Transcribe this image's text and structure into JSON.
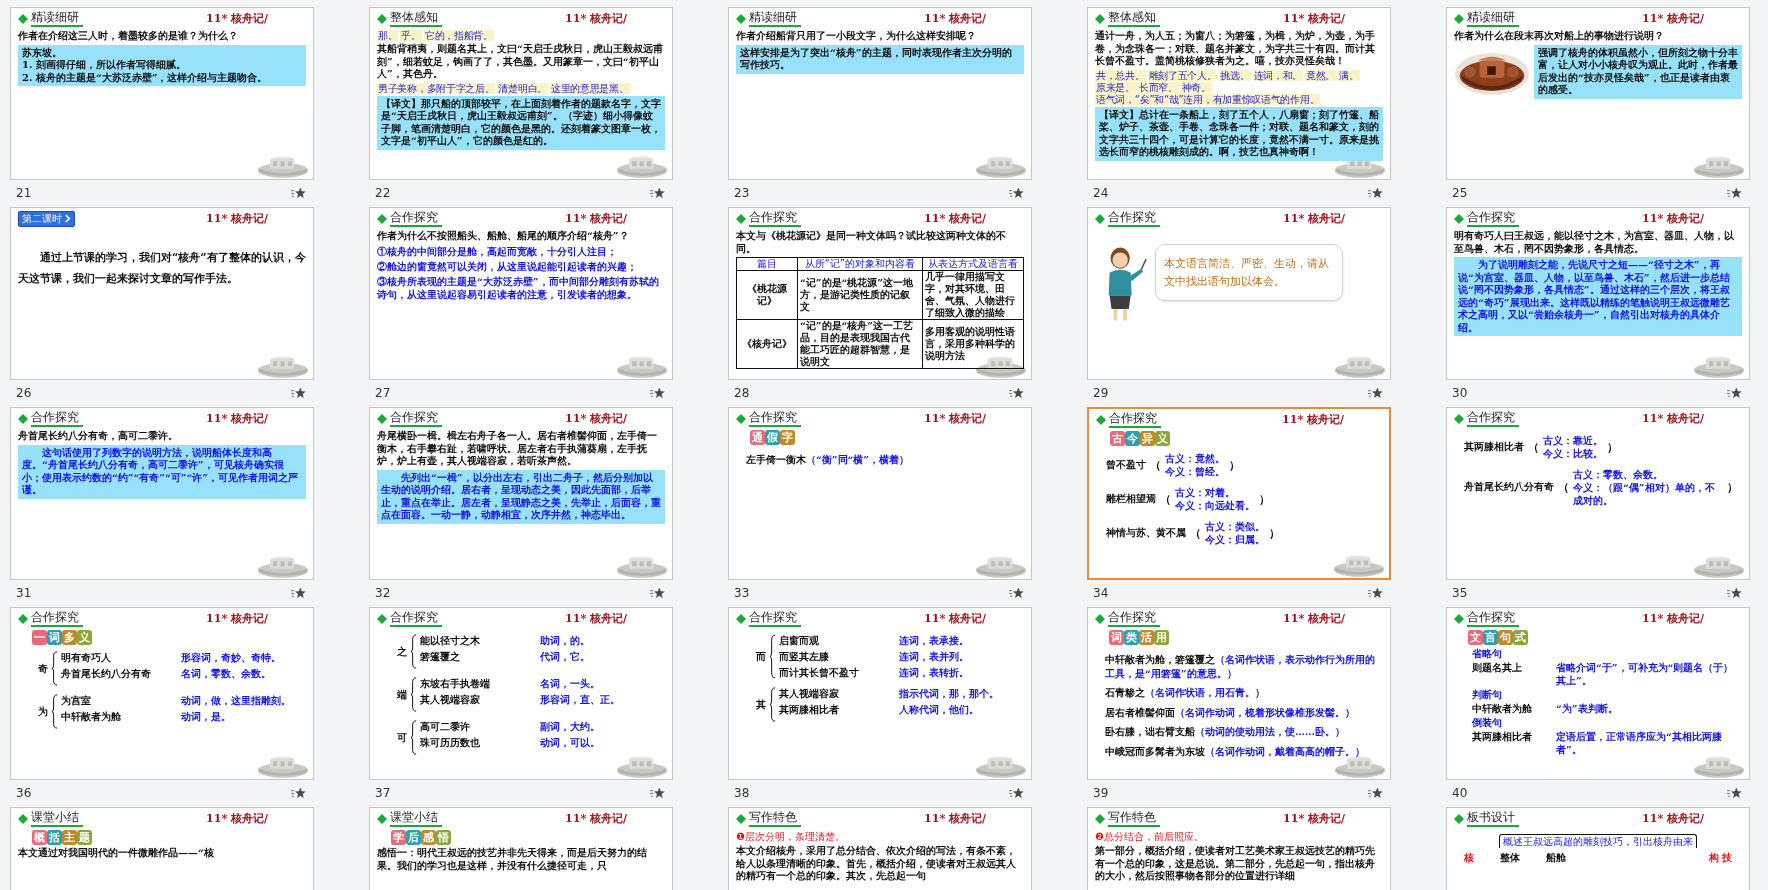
{
  "slides": [
    {
      "number": "21",
      "selected": false,
      "header": {
        "kind": "section",
        "title": "精读细研"
      },
      "brand": "11* 核舟记/",
      "blocks": [
        {
          "kind": "text",
          "text": "作者在介绍这三人时，着墨较多的是谁？为什么？"
        },
        {
          "kind": "box",
          "lines": [
            "苏东坡。",
            "1. 刻画得仔细，所以作者写得细腻。",
            "2. 核舟的主题是“大苏泛赤壁”，这样介绍与主题吻合。"
          ]
        }
      ]
    },
    {
      "number": "22",
      "selected": false,
      "header": {
        "kind": "section",
        "title": "整体感知"
      },
      "brand": "11* 核舟记/",
      "blocks": [
        {
          "kind": "notes",
          "notes": [
            "那。",
            "乎。",
            "它的，指船背。"
          ]
        },
        {
          "kind": "text",
          "text": "**其**船背稍**夷**，则题名**其**上，文曰“天启壬戌秋日，虎山王毅叔远**甫**刻”，细若蚊足，钩画**了了**，其色**墨**。又用篆章一，文曰“初平山人”，其色丹。"
        },
        {
          "kind": "notes",
          "notes": [
            "男子美称，多附于字之后。",
            "清楚明白。",
            "这里的意思是黑。"
          ]
        },
        {
          "kind": "box",
          "lines": [
            "**【译文】**那只船的顶部较平，在上面刻着作者的题款名字，文字是“天启壬戌秋日，虎山王毅叔远甫刻”。（字迹）细小得像蚊子脚，笔画清楚明白，它的颜色是黑的。还刻着篆文图章一枚，文字是“初平山人”，它的颜色是红的。"
          ]
        }
      ]
    },
    {
      "number": "23",
      "selected": false,
      "header": {
        "kind": "section",
        "title": "精读细研"
      },
      "brand": "11* 核舟记/",
      "blocks": [
        {
          "kind": "text",
          "text": "作者介绍船背只用了一小段文字，为什么这样安排呢？"
        },
        {
          "kind": "box",
          "lines": [
            "这样安排是为了突出“核舟”的主题，同时表现作者主次分明的写作技巧。"
          ]
        }
      ]
    },
    {
      "number": "24",
      "selected": false,
      "header": {
        "kind": "section",
        "title": "整体感知"
      },
      "brand": "11* 核舟记/",
      "blocks": [
        {
          "kind": "text",
          "text": "**通**计一舟，**为人五**；为窗八；为箬篷，为楫，为炉，为壶，为手卷，为念珠各一；对联、题名**并**篆文，为字共三十有四。而计其长**曾**不**盈**寸。**盖简**桃核**修狭**者为之。嘻，技亦**灵怪矣哉**！"
        },
        {
          "kind": "notes",
          "notes": [
            "共，总共。",
            "雕刻了五个人。",
            "挑选。",
            "连词，和。",
            "竟然。",
            "满。",
            "原来是。",
            "长而窄。",
            "神奇。",
            "语气词，“矣”和“哉”连用，有加重惊叹语气的作用。"
          ]
        },
        {
          "kind": "box",
          "lines": [
            "**【译文】**总计在一条船上，刻了五个人，八扇窗；刻了竹篷、船桨、炉子、茶壶、手卷、念珠各一件；对联、题名和篆文，刻的文字共三十四个，可是计算它的长度，竟然不满一寸。原来是挑选长而窄的桃核雕刻成的。啊，技艺也真神奇啊！"
          ]
        }
      ]
    },
    {
      "number": "25",
      "selected": false,
      "header": {
        "kind": "section",
        "title": "精读细研"
      },
      "brand": "11* 核舟记/",
      "blocks": [
        {
          "kind": "text",
          "text": "作者为什么在段末再次对船上的事物进行说明？"
        },
        {
          "kind": "figurebox",
          "lines": [
            "强调了核舟的体积虽然小，但所刻之物十分丰富，让人对小小核舟叹为观止。此时，作者最后发出的“技亦灵怪矣哉”，也正是读者由衷的感受。"
          ]
        }
      ]
    },
    {
      "number": "26",
      "selected": false,
      "header": {
        "kind": "lesson",
        "title": "第二课时"
      },
      "brand": "11* 核舟记/",
      "blocks": [
        {
          "kind": "lead",
          "text": "通过上节课的学习，我们对“核舟”有了整体的认识，今天这节课，我们一起来探讨文章的写作手法。"
        }
      ]
    },
    {
      "number": "27",
      "selected": false,
      "header": {
        "kind": "section",
        "title": "合作探究"
      },
      "brand": "11* 核舟记/",
      "blocks": [
        {
          "kind": "text",
          "text": "作者为什么不按照船头、船舱、船尾的顺序介绍“核舟”？"
        },
        {
          "kind": "answer",
          "lines": [
            "①核舟的中间部分是舱，高起而宽敞，十分引人注目；",
            "②舱边的窗竟然可以关闭，从这里说起能引起读者的兴趣；",
            "③核舟所表现的主题是“大苏泛赤壁”，而中间部分雕刻有苏轼的诗句，从这里说起容易引起读者的注意，引发读者的想象。"
          ]
        }
      ]
    },
    {
      "number": "28",
      "selected": false,
      "header": {
        "kind": "section",
        "title": "合作探究"
      },
      "brand": "11* 核舟记/",
      "blocks": [
        {
          "kind": "text",
          "text": "本文与《桃花源记》是同一种文体吗？试比较这两种文体的不同。"
        },
        {
          "kind": "table",
          "columns": [
            "篇目",
            "从所“记”的对象和内容看",
            "从表达方式及语言看"
          ],
          "rows": [
            [
              "《桃花源记》",
              "“记”的是“桃花源”这一地方，是游记类性质的记叙文",
              "几乎一律用描写文字，对其环境、田舍、气氛、人物进行了细致入微的描绘"
            ],
            [
              "《核舟记》",
              "“记”的是“核舟”这一工艺品，目的是表现我国古代能工巧匠的超群智慧，是说明文",
              "多用客观的说明性语言，采用多种科学的说明方法"
            ]
          ]
        }
      ]
    },
    {
      "number": "29",
      "selected": false,
      "header": {
        "kind": "section",
        "title": "合作探究"
      },
      "brand": "11* 核舟记/",
      "blocks": [
        {
          "kind": "bubble",
          "text": "本文语言简洁、严密、生动，请从文中找出语句加以体会。"
        }
      ]
    },
    {
      "number": "30",
      "selected": false,
      "header": {
        "kind": "section",
        "title": "合作探究"
      },
      "brand": "11* 核舟记/",
      "blocks": [
        {
          "kind": "text",
          "text": "明有奇巧人曰王叔远，能以径寸之木，为宫室、器皿、人物，以至鸟兽、木石，罔不因势象形，各具情态。"
        },
        {
          "kind": "bluebox",
          "lines": [
            "为了说明雕刻之能，先说尺寸之短——“径寸之木”，再说“为宫室、器皿、人物，以至鸟兽、木石”，然后进一步总结说“罔不因势象形，各具情态”。通过这样的三个层次，将王叔远的“奇巧”展现出来。这样既以精练的笔触说明王叔远微雕艺术之高明，又以“尝贻余核舟一”，自然引出对核舟的具体介绍。"
          ]
        }
      ]
    },
    {
      "number": "31",
      "selected": false,
      "header": {
        "kind": "section",
        "title": "合作探究"
      },
      "brand": "11* 核舟记/",
      "blocks": [
        {
          "kind": "text",
          "text": "舟首尾长约**八**分有奇，高可**二**黍许。"
        },
        {
          "kind": "bluebox",
          "lines": [
            "这句话使用了列数字的说明方法，说明船体长度和高度。“舟首尾长约八分有奇，高可二黍许”，可见核舟确实很小；使用表示约数的“约”“有奇”“可”“许”，可见作者用词之严谨。"
          ]
        }
      ]
    },
    {
      "number": "32",
      "selected": false,
      "header": {
        "kind": "section",
        "title": "合作探究"
      },
      "brand": "11* 核舟记/",
      "blocks": [
        {
          "kind": "text",
          "text": "舟尾横卧一楫。楫左右舟子各一人。居右者椎髻仰面，左手倚一衡木，右手攀右趾，若啸呼状。居左者右手执蒲葵扇，左手抚炉，炉上有壶，其人视端容寂，若听茶声然。"
        },
        {
          "kind": "bluebox",
          "lines": [
            "先列出“一楫”，以分出左右，引出二舟子，然后分别加以生动的说明介绍。居右者，呈现动态之美，因此先面部，后举止，重点在举止。居左者，呈现静态之美，先举止，后面容，重点在面容。一动一静，动静相宜，次序井然，神态毕出。"
          ]
        }
      ]
    },
    {
      "number": "33",
      "selected": false,
      "header": {
        "kind": "section",
        "title": "合作探究"
      },
      "brand": "11* 核舟记/",
      "blocks": [
        {
          "kind": "badge",
          "text": "通假字"
        },
        {
          "kind": "usages",
          "items": [
            {
              "text": "左手倚一**衡**木",
              "note": "（“衡”同“横”，横着）"
            }
          ]
        }
      ]
    },
    {
      "number": "34",
      "selected": true,
      "header": {
        "kind": "section",
        "title": "合作探究"
      },
      "brand": "11* 核舟记/",
      "blocks": [
        {
          "kind": "badge",
          "text": "古今异义"
        },
        {
          "kind": "glosses",
          "open": "（",
          "close": "）",
          "items": [
            {
              "text": "**曾**不盈寸",
              "ancient": "古义：竟然。",
              "modern": "今义：曾经。"
            },
            {
              "text": "雕栏相**望**焉",
              "ancient": "古义：对着。",
              "modern": "今义：向远处看。"
            },
            {
              "text": "神情与苏、黄不**属**",
              "ancient": "古义：类似。",
              "modern": "今义：归属。"
            }
          ]
        }
      ]
    },
    {
      "number": "35",
      "selected": false,
      "header": {
        "kind": "section",
        "title": "合作探究"
      },
      "brand": "11* 核舟记/",
      "blocks": [
        {
          "kind": "glosses",
          "open": "（",
          "close": "）",
          "items": [
            {
              "text": "其两膝相**比**者",
              "ancient": "古义：靠近。",
              "modern": "今义：比较。"
            },
            {
              "text": "舟首尾长约八分有**奇**",
              "ancient": "古义：零数、余数。",
              "modern": "今义：（跟“偶”相对）单的，不成对的。"
            }
          ]
        }
      ]
    },
    {
      "number": "36",
      "selected": false,
      "header": {
        "kind": "section",
        "title": "合作探究"
      },
      "brand": "11* 核舟记/",
      "blocks": [
        {
          "kind": "badge",
          "text": "一词多义"
        },
        {
          "kind": "braces",
          "groups": [
            {
              "head": "奇",
              "items": [
                {
                  "text": "明有**奇**巧人",
                  "note": "形容词，奇妙、奇特。"
                },
                {
                  "text": "舟首尾长约八分有**奇**",
                  "note": "名词，零数、余数。"
                }
              ]
            },
            {
              "head": "为",
              "items": [
                {
                  "text": "**为**宫室",
                  "note": "动词，做，这里指雕刻。"
                },
                {
                  "text": "中轩敞者**为**舱",
                  "note": "动词，是。"
                }
              ]
            }
          ]
        }
      ]
    },
    {
      "number": "37",
      "selected": false,
      "header": {
        "kind": "section",
        "title": "合作探究"
      },
      "brand": "11* 核舟记/",
      "blocks": [
        {
          "kind": "braces",
          "groups": [
            {
              "head": "之",
              "items": [
                {
                  "text": "能以径寸**之**木",
                  "note": "助词，的。"
                },
                {
                  "text": "箬篷覆**之**",
                  "note": "代词，它。"
                }
              ]
            },
            {
              "head": "端",
              "items": [
                {
                  "text": "东坡右手执卷**端**",
                  "note": "名词，一头。"
                },
                {
                  "text": "其人视**端**容寂",
                  "note": "形容词，直、正。"
                }
              ]
            },
            {
              "head": "可",
              "items": [
                {
                  "text": "高**可**二黍许",
                  "note": "副词，大约。"
                },
                {
                  "text": "珠**可**历历数也",
                  "note": "动词，可以。"
                }
              ]
            }
          ]
        }
      ]
    },
    {
      "number": "38",
      "selected": false,
      "header": {
        "kind": "section",
        "title": "合作探究"
      },
      "brand": "11* 核舟记/",
      "blocks": [
        {
          "kind": "braces",
          "groups": [
            {
              "head": "而",
              "items": [
                {
                  "text": "启窗**而**观",
                  "note": "连词，表承接。"
                },
                {
                  "text": "**而**竖其左膝",
                  "note": "连词，表并列。"
                },
                {
                  "text": "**而**计其长曾不盈寸",
                  "note": "连词，表转折。"
                }
              ]
            },
            {
              "head": "其",
              "items": [
                {
                  "text": "**其**人视端容寂",
                  "note": "指示代词，那，那个。"
                },
                {
                  "text": "**其**两膝相比者",
                  "note": "人称代词，他们。"
                }
              ]
            }
          ]
        }
      ]
    },
    {
      "number": "39",
      "selected": false,
      "header": {
        "kind": "section",
        "title": "合作探究"
      },
      "brand": "11* 核舟记/",
      "blocks": [
        {
          "kind": "badge",
          "text": "词类活用"
        },
        {
          "kind": "usages",
          "items": [
            {
              "text": "中轩敞者为舱，**箬篷**覆之",
              "note": "（名词作状语，表示动作行为所用的工具，是“用箬篷”的意思。）"
            },
            {
              "text": "**石青**糁之",
              "note": "（名词作状语，用石青。）"
            },
            {
              "text": "居右者椎**髻**仰面",
              "note": "（名词作动词，梳着形状像椎形发髻。）"
            },
            {
              "text": "**卧**右膝，诎右臂支船",
              "note": "（动词的使动用法，使……卧。）"
            },
            {
              "text": "中**峨冠**而多髯者为东坡",
              "note": "（名词作动词，戴着高高的帽子。）"
            }
          ]
        }
      ]
    },
    {
      "number": "40",
      "selected": false,
      "header": {
        "kind": "section",
        "title": "合作探究"
      },
      "brand": "11* 核舟记/",
      "blocks": [
        {
          "kind": "badge",
          "text": "文言句式"
        },
        {
          "kind": "syntax",
          "items": [
            {
              "label": "省略句",
              "text": "则题名其上",
              "note": "省略介词“于”，可补充为“则题名（于）其上”。"
            },
            {
              "label": "判断句",
              "text": "中轩敞者为舱",
              "note": "“为”表判断。"
            },
            {
              "label": "倒装句",
              "text": "其两膝相比者",
              "note": "定语后置，正常语序应为“其相比两膝者”。"
            }
          ]
        }
      ]
    },
    {
      "selected": false,
      "header": {
        "kind": "section",
        "title": "课堂小结"
      },
      "brand": "11* 核舟记/",
      "blocks": [
        {
          "kind": "badge",
          "text": "概括主题"
        },
        {
          "kind": "text",
          "text": "本文通过对我国明代的一件微雕作品——“核"
        }
      ]
    },
    {
      "selected": false,
      "header": {
        "kind": "section",
        "title": "课堂小结"
      },
      "brand": "11* 核舟记/",
      "blocks": [
        {
          "kind": "badge",
          "text": "学后感悟"
        },
        {
          "kind": "text",
          "text": "**感悟一：**明代王叔远的技艺并非先天得来，而是后天努力的结果。我们的学习也是这样，并没有什么捷径可走，只"
        }
      ]
    },
    {
      "selected": false,
      "header": {
        "kind": "section",
        "title": "写作特色"
      },
      "brand": "11* 核舟记/",
      "blocks": [
        {
          "kind": "subhead",
          "text": "❶层次分明，条理清楚。"
        },
        {
          "kind": "text",
          "text": "本文介绍核舟，采用了总分结合、依次介绍的写法，有条不紊，给人以条理清晰的印象。首先，概括介绍，使读者对王叔远其人的精巧有一个总的印象。其次，先总起一句"
        }
      ]
    },
    {
      "selected": false,
      "header": {
        "kind": "section",
        "title": "写作特色"
      },
      "brand": "11* 核舟记/",
      "blocks": [
        {
          "kind": "subhead",
          "text": "❷总分结合，前后照应。"
        },
        {
          "kind": "text",
          "text": "第一部分，概括介绍，使读者对工艺美术家王叔远技艺的精巧先有一个总的印象，这是总说。第二部分，先总起一句，指出核舟的大小，然后按照事物各部分的位置进行详细"
        }
      ]
    },
    {
      "selected": false,
      "header": {
        "kind": "section",
        "title": "板书设计"
      },
      "brand": "11* 核舟记/",
      "blocks": [
        {
          "kind": "outline",
          "top": "概述王叔远高超的雕刻技巧，引出核舟由来",
          "left": "核",
          "items": [
            "整体",
            "船舱"
          ],
          "right": "构 技"
        }
      ]
    }
  ]
}
